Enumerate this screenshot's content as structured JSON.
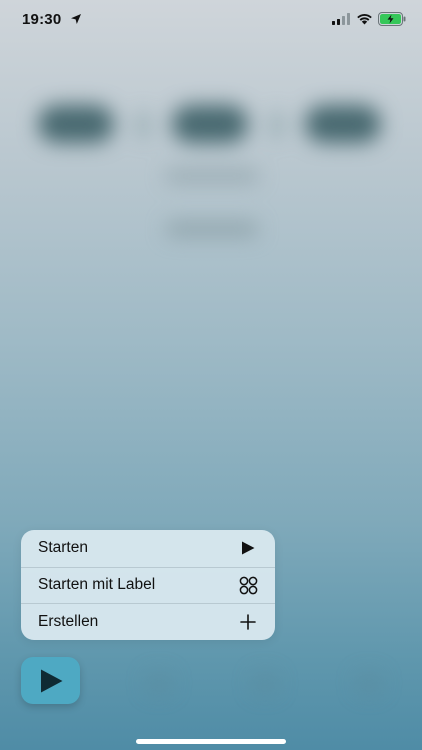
{
  "status_bar": {
    "time": "19:30",
    "icons": [
      "location-arrow-icon",
      "cellular-signal-icon",
      "wifi-icon",
      "battery-charging-icon"
    ],
    "battery_color": "#35c759"
  },
  "context_menu": {
    "items": [
      {
        "label": "Starten",
        "icon": "play-icon"
      },
      {
        "label": "Starten mit Label",
        "icon": "grid-circles-icon"
      },
      {
        "label": "Erstellen",
        "icon": "plus-icon"
      }
    ]
  },
  "fab": {
    "icon": "play-icon",
    "color": "#4ea9c3"
  },
  "colors": {
    "menu_background": "#d7e7ee",
    "background_top": "#cfd5da",
    "background_bottom": "#4f8ca6"
  }
}
